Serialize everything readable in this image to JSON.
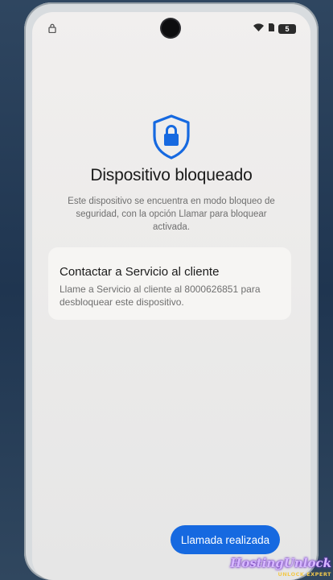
{
  "status_bar": {
    "battery": "5",
    "icons": [
      "lock-icon",
      "wifi-icon",
      "sim-icon",
      "battery-icon"
    ]
  },
  "lock_screen": {
    "icon": "shield-lock-icon",
    "title": "Dispositivo bloqueado",
    "subtitle": "Este dispositivo se encuentra en modo bloqueo de seguridad, con la opción Llamar para bloquear activada."
  },
  "contact_card": {
    "title": "Contactar a Servicio al cliente",
    "body": "Llame a Servicio al cliente al 8000626851 para desbloquear este dispositivo."
  },
  "call_button": {
    "label": "Llamada realizada"
  },
  "watermark": {
    "brand": "HostingUnlock",
    "tagline_a": "UNLOCK",
    "tagline_b": "EXPERT"
  },
  "colors": {
    "accent": "#1669e0",
    "title_text": "#1b1b1b",
    "secondary_text": "#6f6f6f"
  }
}
